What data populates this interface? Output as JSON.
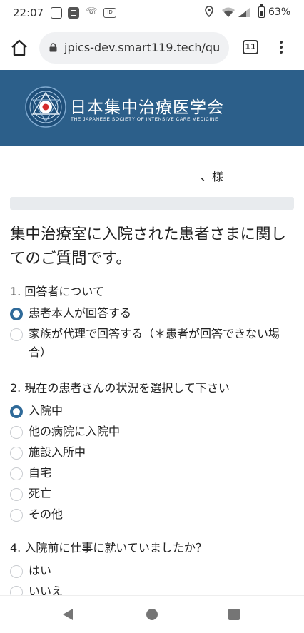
{
  "status_bar": {
    "time": "22:07",
    "battery": "63%",
    "icons": [
      "app-icon",
      "app-grid-icon",
      "wifi-call-icon",
      "id-icon",
      "location-icon",
      "wifi-icon",
      "signal-icon",
      "battery-icon"
    ]
  },
  "browser": {
    "url": "jpics-dev.smart119.tech/qu",
    "tab_count": "11"
  },
  "header": {
    "org_name": "日本集中治療医学会",
    "org_subtitle": "THE JAPANESE SOCIETY OF INTENSIVE CARE MEDICINE"
  },
  "recipient_suffix": "、様",
  "page_title": "集中治療室に入院された患者さまに関してのご質問です。",
  "questions": [
    {
      "title": "1. 回答者について",
      "options": [
        {
          "label": "患者本人が回答する",
          "checked": true
        },
        {
          "label": "家族が代理で回答する（＊患者が回答できない場合）",
          "checked": false
        }
      ]
    },
    {
      "title": "2. 現在の患者さんの状況を選択して下さい",
      "options": [
        {
          "label": "入院中",
          "checked": true
        },
        {
          "label": "他の病院に入院中",
          "checked": false
        },
        {
          "label": "施設入所中",
          "checked": false
        },
        {
          "label": "自宅",
          "checked": false
        },
        {
          "label": "死亡",
          "checked": false
        },
        {
          "label": "その他",
          "checked": false
        }
      ]
    },
    {
      "title": "4. 入院前に仕事に就いていましたか？",
      "options": [
        {
          "label": "はい",
          "checked": false
        },
        {
          "label": "いいえ",
          "checked": false
        }
      ]
    }
  ],
  "colors": {
    "banner": "#2c5f8a",
    "radio_checked": "#2f6a99"
  }
}
